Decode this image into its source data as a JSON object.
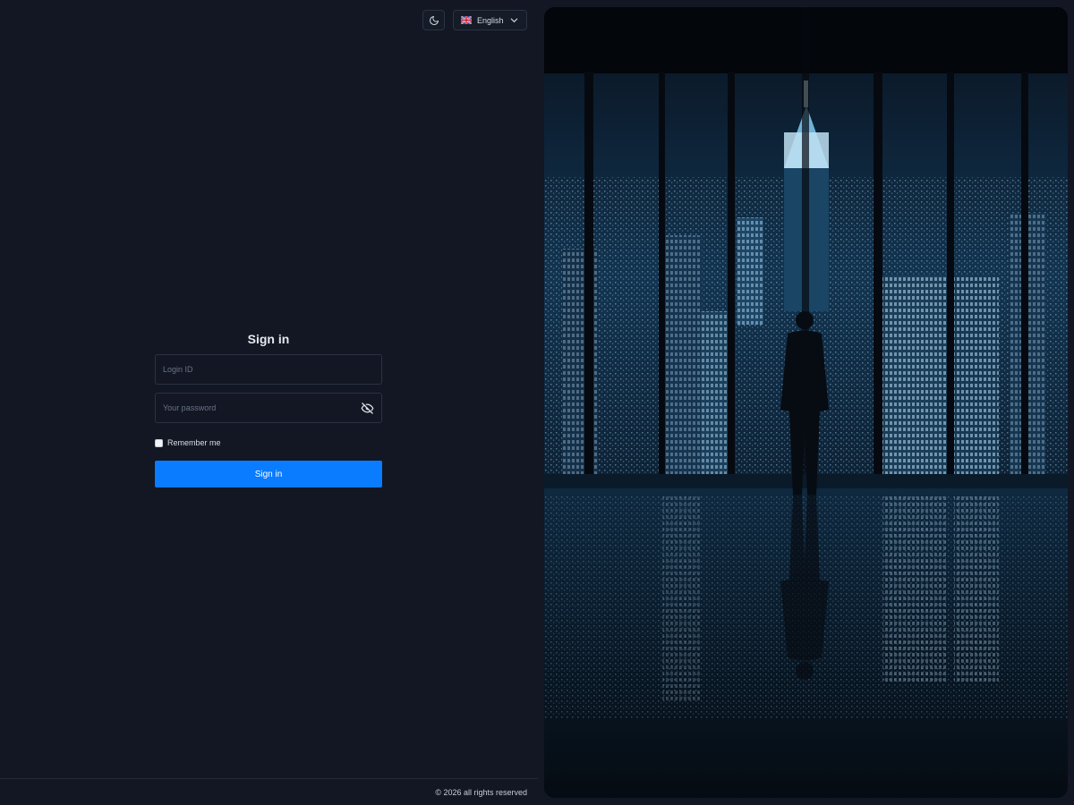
{
  "header": {
    "theme_toggle_icon": "moon-icon",
    "language": {
      "flag_icon": "uk-flag-icon",
      "label": "English",
      "chevron_icon": "chevron-down-icon"
    }
  },
  "login": {
    "title": "Sign in",
    "login_id_placeholder": "Login ID",
    "password_placeholder": "Your password",
    "password_toggle_icon": "eye-off-icon",
    "remember_label": "Remember me",
    "submit_label": "Sign in"
  },
  "footer": {
    "copyright": "© 2026 all rights reserved"
  },
  "hero": {
    "image_description_icon": "city-night-skyline-image"
  },
  "colors": {
    "background": "#121723",
    "primary_button": "#0a7cff",
    "border": "#2b3242"
  }
}
